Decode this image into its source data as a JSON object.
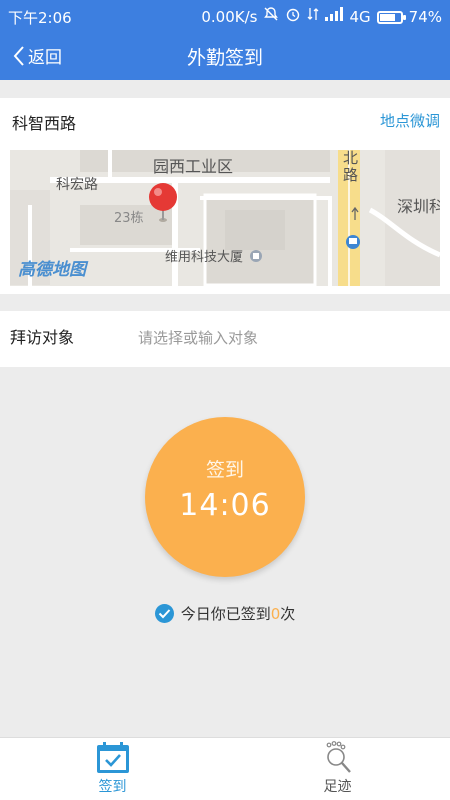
{
  "status_bar": {
    "time": "下午2:06",
    "net_speed": "0.00K/s",
    "network": "4G",
    "battery": "74%",
    "battery_level": 0.74
  },
  "header": {
    "back_label": "返回",
    "title": "外勤签到"
  },
  "location": {
    "name": "科智西路",
    "adjust_label": "地点微调",
    "map_labels": {
      "area": "园西工业区",
      "road1": "科宏路",
      "building_no": "23栋",
      "building": "维用科技大厦",
      "road2": "北路",
      "district": "深圳科",
      "logo": "高德地图"
    }
  },
  "visit": {
    "label": "拜访对象",
    "placeholder": "请选择或输入对象",
    "value": ""
  },
  "sign": {
    "button_label": "签到",
    "time": "14:06",
    "status_prefix": "今日你已签到",
    "count": "0",
    "status_suffix": "次"
  },
  "tabs": [
    {
      "label": "签到",
      "icon": "calendar-check-icon",
      "active": true
    },
    {
      "label": "足迹",
      "icon": "footprint-search-icon",
      "active": false
    }
  ],
  "colors": {
    "header": "#3d7fe0",
    "accent": "#2b96d6",
    "sign_button": "#fbb04e",
    "pin": "#e53935"
  }
}
